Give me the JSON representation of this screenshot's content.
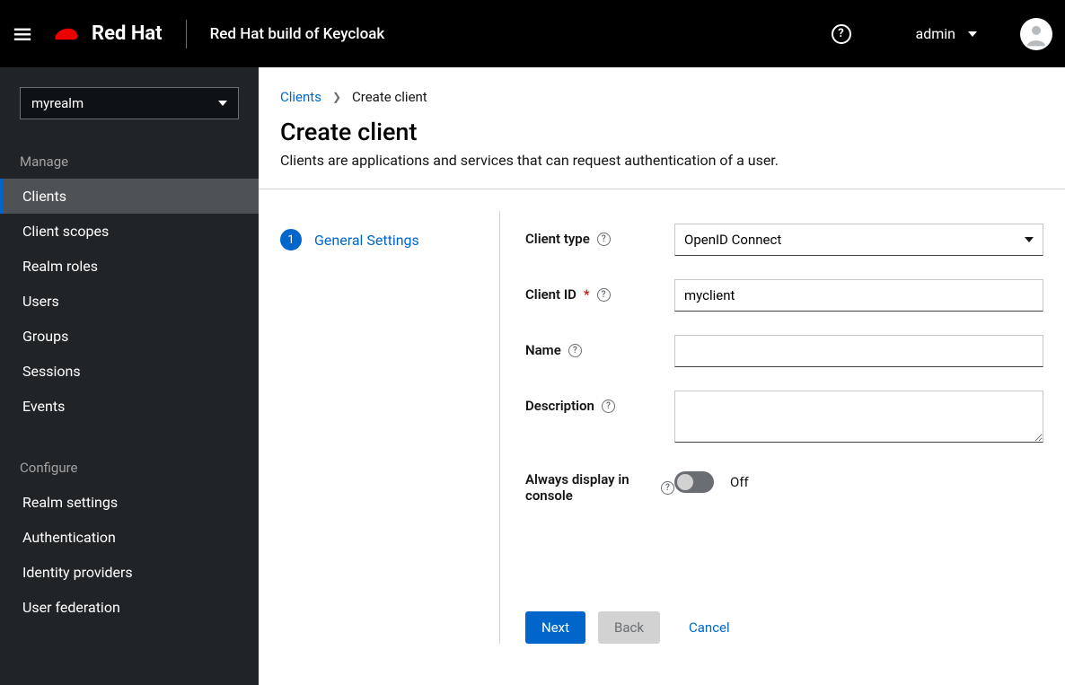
{
  "header": {
    "brand_name": "Red Hat",
    "app_title": "Red Hat build of Keycloak",
    "user_name": "admin"
  },
  "sidebar": {
    "realm": "myrealm",
    "groups": [
      {
        "label": "Manage",
        "items": [
          {
            "label": "Clients",
            "active": true
          },
          {
            "label": "Client scopes",
            "active": false
          },
          {
            "label": "Realm roles",
            "active": false
          },
          {
            "label": "Users",
            "active": false
          },
          {
            "label": "Groups",
            "active": false
          },
          {
            "label": "Sessions",
            "active": false
          },
          {
            "label": "Events",
            "active": false
          }
        ]
      },
      {
        "label": "Configure",
        "items": [
          {
            "label": "Realm settings",
            "active": false
          },
          {
            "label": "Authentication",
            "active": false
          },
          {
            "label": "Identity providers",
            "active": false
          },
          {
            "label": "User federation",
            "active": false
          }
        ]
      }
    ]
  },
  "breadcrumb": {
    "link": "Clients",
    "current": "Create client"
  },
  "page": {
    "title": "Create client",
    "description": "Clients are applications and services that can request authentication of a user."
  },
  "wizard": {
    "step_number": "1",
    "step_label": "General Settings"
  },
  "form": {
    "client_type_label": "Client type",
    "client_type_value": "OpenID Connect",
    "client_id_label": "Client ID",
    "client_id_value": "myclient",
    "name_label": "Name",
    "name_value": "",
    "description_label": "Description",
    "description_value": "",
    "always_display_label": "Always display in console",
    "always_display_state": "Off"
  },
  "buttons": {
    "next": "Next",
    "back": "Back",
    "cancel": "Cancel"
  }
}
